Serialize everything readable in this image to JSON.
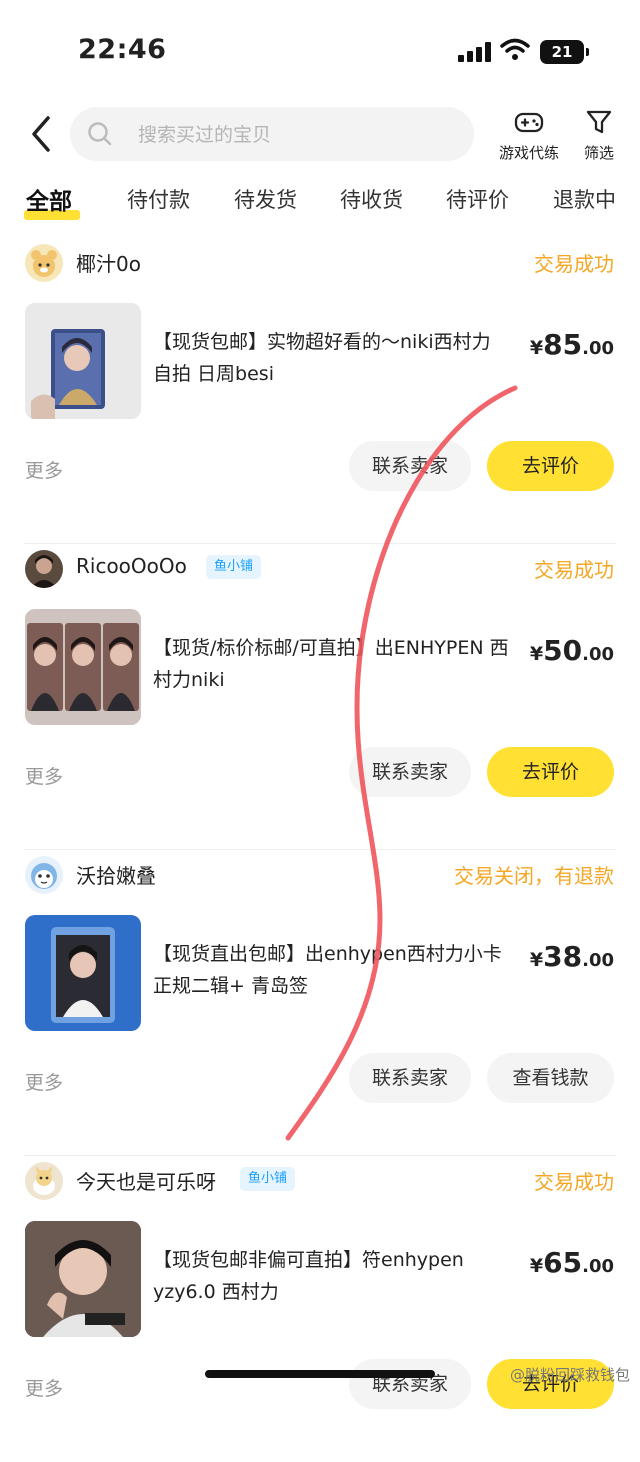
{
  "status_bar": {
    "time": "22:46",
    "battery": "21"
  },
  "search": {
    "placeholder": "搜索买过的宝贝"
  },
  "top_actions": [
    {
      "label": "游戏代练",
      "icon": "gamepad-icon"
    },
    {
      "label": "筛选",
      "icon": "filter-icon"
    }
  ],
  "tabs": [
    "全部",
    "待付款",
    "待发货",
    "待收货",
    "待评价",
    "退款中"
  ],
  "orders": [
    {
      "seller": "椰汁0o",
      "badge": "",
      "status": "交易成功",
      "title": "【现货包邮】实物超好看的～niki西村力 自拍 日周besi",
      "price": {
        "currency": "¥",
        "int": "85",
        "dec": ".00"
      },
      "more": "更多",
      "btn1": "联系卖家",
      "btn2": "去评价"
    },
    {
      "seller": "RicooOoOo",
      "badge": "鱼小铺",
      "status": "交易成功",
      "title": "【现货/标价标邮/可直拍】出ENHYPEN 西村力niki",
      "price": {
        "currency": "¥",
        "int": "50",
        "dec": ".00"
      },
      "more": "更多",
      "btn1": "联系卖家",
      "btn2": "去评价"
    },
    {
      "seller": "沃拾嫩叠",
      "badge": "",
      "status": "交易关闭，有退款",
      "title": "【现货直出包邮】出enhypen西村力小卡正规二辑+ 青岛签",
      "price": {
        "currency": "¥",
        "int": "38",
        "dec": ".00"
      },
      "more": "更多",
      "btn1": "联系卖家",
      "btn2": "查看钱款"
    },
    {
      "seller": "今天也是可乐呀",
      "badge": "鱼小铺",
      "status": "交易成功",
      "title": "【现货包邮非偏可直拍】符enhypen yzy6.0 西村力",
      "price": {
        "currency": "¥",
        "int": "65",
        "dec": ".00"
      },
      "more": "更多",
      "btn1": "联系卖家",
      "btn2": "去评价"
    }
  ],
  "watermark": "@脱粉回踩救钱包",
  "colors": {
    "accent": "#ffe033",
    "status_text": "#f5a623",
    "badge_text": "#1aa0ff",
    "scribble": "#f0545c"
  }
}
